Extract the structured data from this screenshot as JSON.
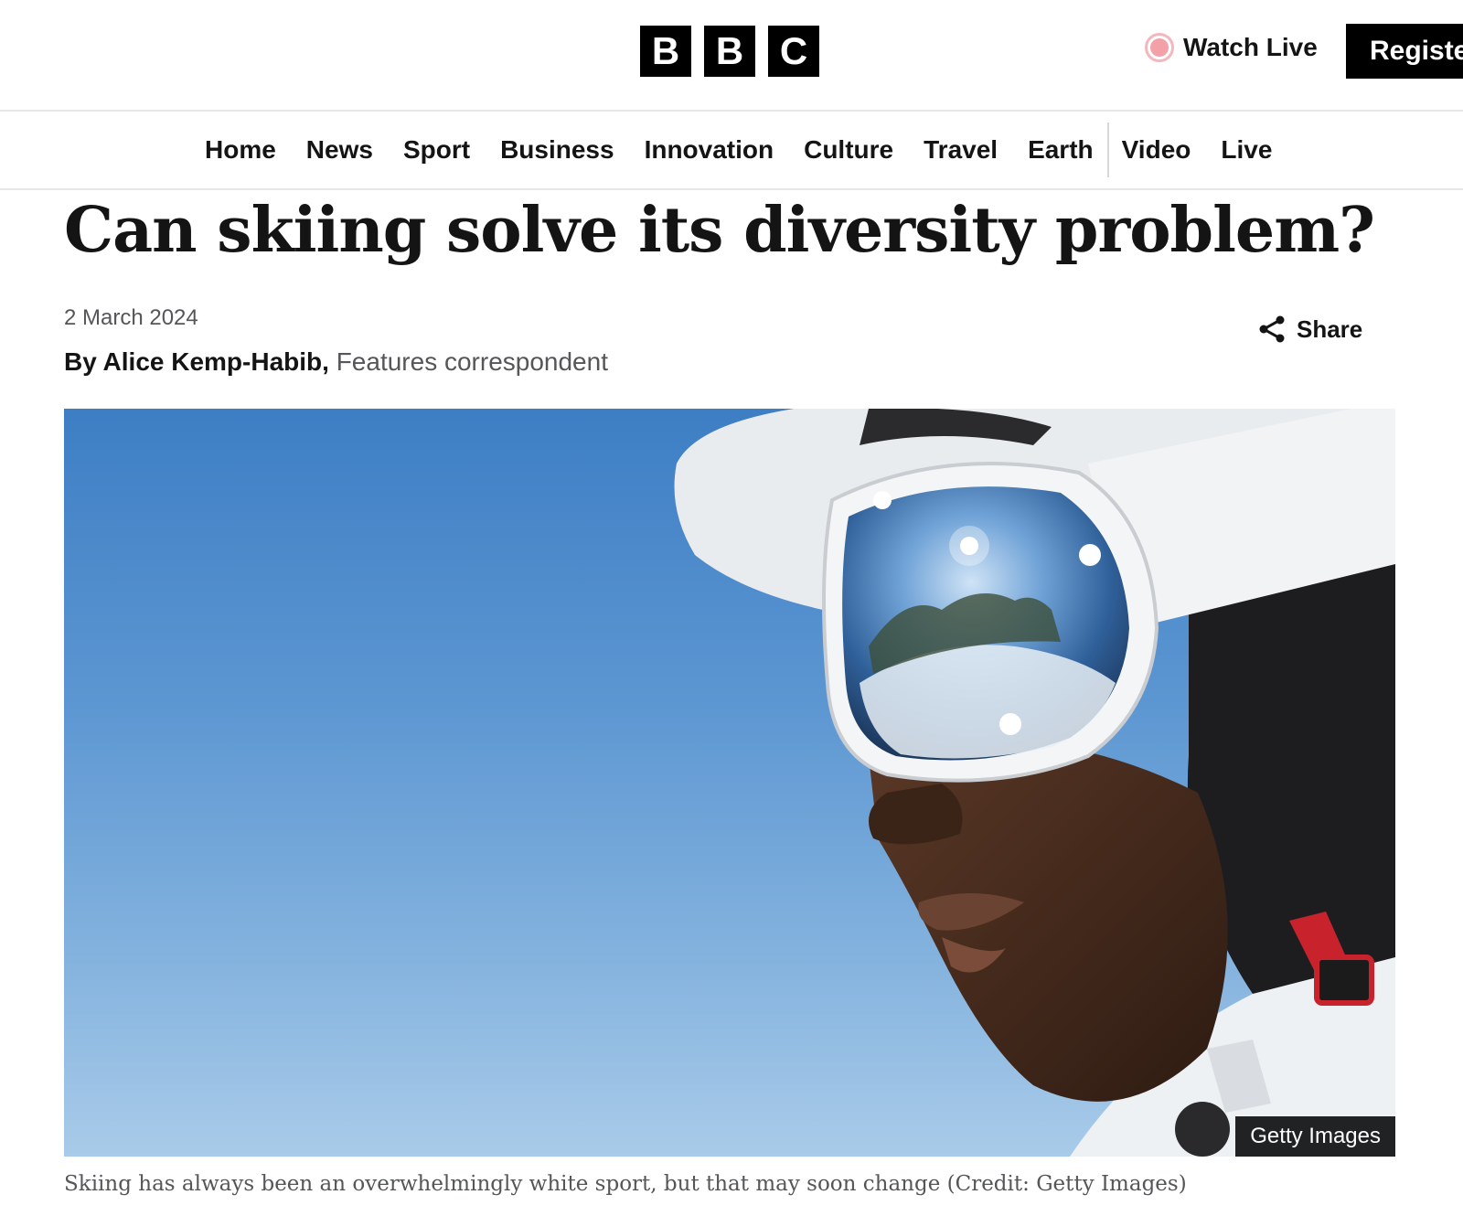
{
  "header": {
    "logo_letters": [
      "B",
      "B",
      "C"
    ],
    "watch_live_label": "Watch Live",
    "register_label": "Register"
  },
  "nav": {
    "items": [
      "Home",
      "News",
      "Sport",
      "Business",
      "Innovation",
      "Culture",
      "Travel",
      "Earth",
      "Video",
      "Live"
    ]
  },
  "article": {
    "headline": "Can skiing solve its diversity problem?",
    "date": "2 March 2024",
    "byline_author": "By Alice Kemp-Habib,",
    "byline_role": "Features correspondent",
    "share_label": "Share",
    "image_credit_badge": "Getty Images",
    "caption": "Skiing has always been an overwhelmingly white sport, but that may soon change (Credit: Getty Images)"
  },
  "colors": {
    "live_dot": "#f4a0a9",
    "sky_top": "#3d7ec4",
    "sky_bottom": "#a9cbe9"
  }
}
